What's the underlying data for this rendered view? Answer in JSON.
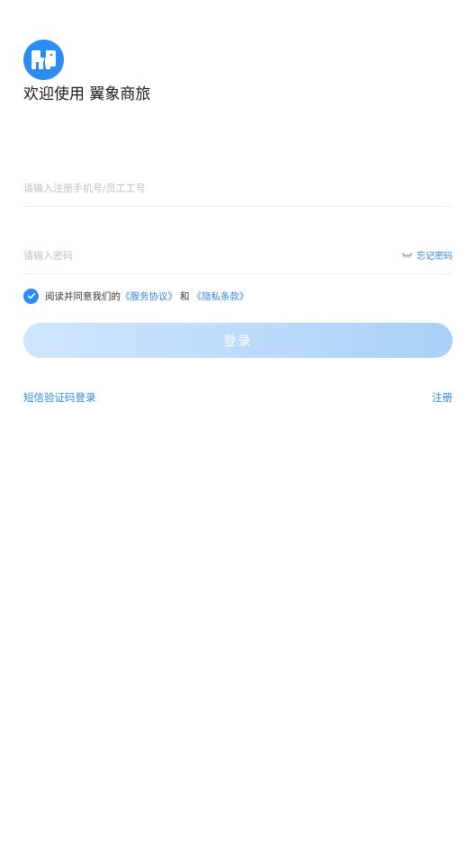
{
  "app": {
    "logo_icon": "elephant-logo-icon",
    "welcome": "欢迎使用 翼象商旅",
    "brand_color": "#2c8cf0"
  },
  "form": {
    "phone_placeholder": "请输入注册手机号/员工工号",
    "phone_value": "",
    "password_placeholder": "请输入密码",
    "password_value": "",
    "eye_icon": "eye-closed-icon",
    "forgot_label": "忘记密码"
  },
  "agreement": {
    "checked": true,
    "check_icon": "checkmark-icon",
    "prefix": "阅读并同意我们的",
    "service_link": "《服务协议》",
    "and": "和",
    "privacy_link": "《隐私条款》"
  },
  "actions": {
    "login_label": "登录",
    "sms_login_label": "短信验证码登录",
    "register_label": "注册"
  }
}
